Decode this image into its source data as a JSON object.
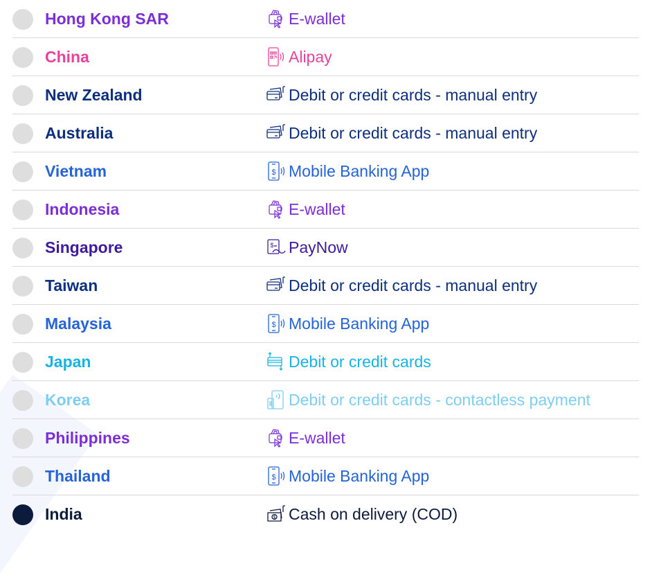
{
  "rows": [
    {
      "country": "Hong Kong SAR",
      "method": "E-wallet",
      "icon": "e-wallet-icon",
      "color": "#7b2fd6",
      "selected": false
    },
    {
      "country": "China",
      "method": "Alipay",
      "icon": "qr-phone-icon",
      "color": "#e8439a",
      "selected": false
    },
    {
      "country": "New Zealand",
      "method": "Debit or credit cards - manual entry",
      "icon": "card-terminal-icon",
      "color": "#0d2f80",
      "selected": false
    },
    {
      "country": "Australia",
      "method": "Debit or credit cards - manual entry",
      "icon": "card-terminal-icon",
      "color": "#0d2f80",
      "selected": false
    },
    {
      "country": "Vietnam",
      "method": "Mobile Banking App",
      "icon": "mobile-banking-icon",
      "color": "#2563d9",
      "selected": false
    },
    {
      "country": "Indonesia",
      "method": "E-wallet",
      "icon": "e-wallet-icon",
      "color": "#7b2fd6",
      "selected": false
    },
    {
      "country": "Singapore",
      "method": "PayNow",
      "icon": "paynow-icon",
      "color": "#3d1a9e",
      "selected": false
    },
    {
      "country": "Taiwan",
      "method": "Debit or credit cards - manual entry",
      "icon": "card-terminal-icon",
      "color": "#0d2f80",
      "selected": false
    },
    {
      "country": "Malaysia",
      "method": "Mobile Banking App",
      "icon": "mobile-banking-icon",
      "color": "#2563d9",
      "selected": false
    },
    {
      "country": "Japan",
      "method": "Debit or credit cards",
      "icon": "card-swap-icon",
      "color": "#16b3e4",
      "selected": false
    },
    {
      "country": "Korea",
      "method": "Debit or credit cards - contactless payment",
      "icon": "contactless-icon",
      "color": "#7fcdf3",
      "selected": false
    },
    {
      "country": "Philippines",
      "method": "E-wallet",
      "icon": "e-wallet-icon",
      "color": "#7b2fd6",
      "selected": false
    },
    {
      "country": "Thailand",
      "method": "Mobile Banking App",
      "icon": "mobile-banking-icon",
      "color": "#2563d9",
      "selected": false
    },
    {
      "country": "India",
      "method": "Cash on delivery (COD)",
      "icon": "cash-icon",
      "color": "#0c1a3c",
      "selected": true
    }
  ]
}
